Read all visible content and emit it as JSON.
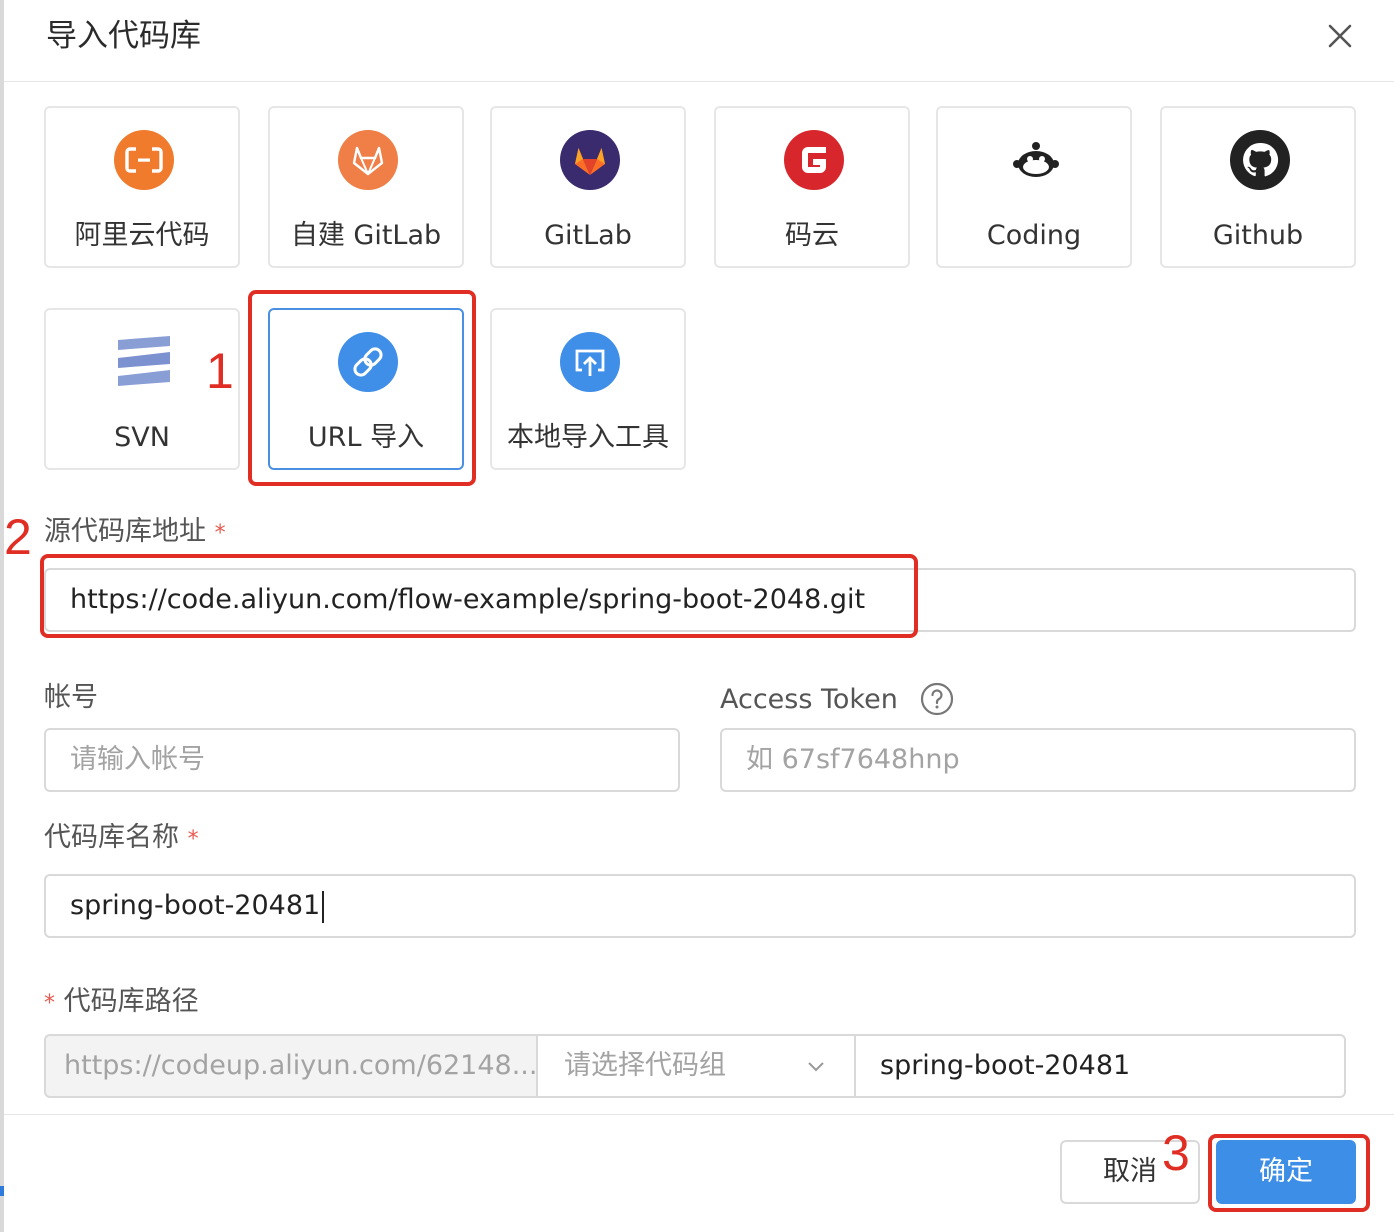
{
  "dialog": {
    "title": "导入代码库",
    "close_icon": "close-icon"
  },
  "sources": [
    {
      "label": "阿里云代码",
      "icon": "aliyun-icon",
      "color": "#f07b2c"
    },
    {
      "label": "自建 GitLab",
      "icon": "gitlab-self-hosted-icon",
      "color": "#ef7e47"
    },
    {
      "label": "GitLab",
      "icon": "gitlab-icon",
      "color": "#3a2a6e"
    },
    {
      "label": "码云",
      "icon": "gitee-icon",
      "color": "#d8272c"
    },
    {
      "label": "Coding",
      "icon": "coding-icon",
      "color": "#222222"
    },
    {
      "label": "Github",
      "icon": "github-icon",
      "color": "#222222"
    },
    {
      "label": "SVN",
      "icon": "svn-icon",
      "color": "#8a9ed6"
    },
    {
      "label": "URL 导入",
      "icon": "link-icon",
      "color": "#3f8ee8",
      "selected": true
    },
    {
      "label": "本地导入工具",
      "icon": "upload-icon",
      "color": "#3f8ee8"
    }
  ],
  "annotations": {
    "step1": "1",
    "step2": "2",
    "step3": "3"
  },
  "form": {
    "source_url": {
      "label": "源代码库地址",
      "required_mark": "*",
      "value": "https://code.aliyun.com/flow-example/spring-boot-2048.git"
    },
    "account": {
      "label": "帐号",
      "placeholder": "请输入帐号"
    },
    "access_token": {
      "label": "Access Token",
      "placeholder": "如 67sf7648hnp",
      "help_icon": "question-circle-icon"
    },
    "repo_name": {
      "label": "代码库名称",
      "required_mark": "*",
      "value": "spring-boot-20481"
    },
    "repo_path": {
      "label": "代码库路径",
      "required_mark": "*",
      "prefix": "https://codeup.aliyun.com/62148...",
      "group_placeholder": "请选择代码组",
      "name_value": "spring-boot-20481"
    }
  },
  "footer": {
    "cancel_label": "取消",
    "ok_label": "确定",
    "ok_color": "#3d8ee6"
  },
  "colors": {
    "accent": "#3d8ee6",
    "annotation_red": "#e02e24",
    "required": "#e8594f"
  }
}
